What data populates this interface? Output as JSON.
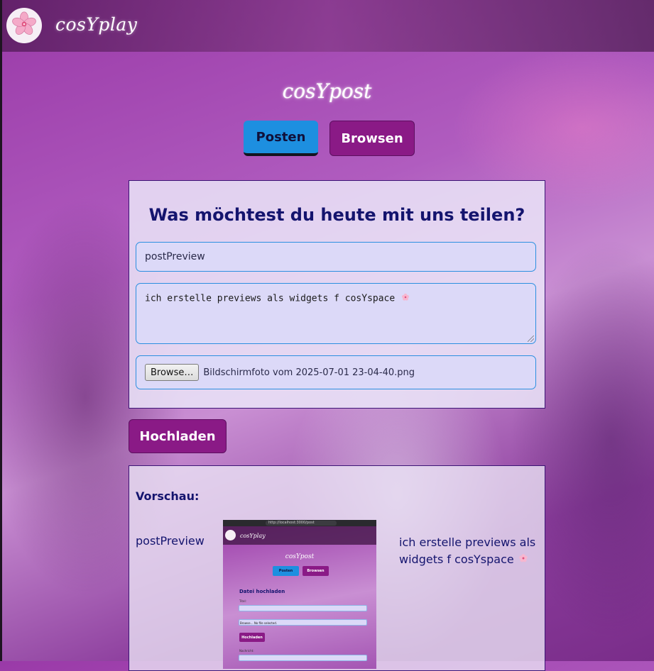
{
  "header": {
    "brand": "cosYplay",
    "logo_icon": "cherry-blossom-icon"
  },
  "page": {
    "title": "cosYpost"
  },
  "tabs": [
    {
      "label": "Posten",
      "active": true,
      "color": "#1d8fe0"
    },
    {
      "label": "Browsen",
      "active": false,
      "color": "#8a1a86"
    }
  ],
  "form": {
    "heading": "Was möchtest du heute mit uns teilen?",
    "title_value": "postPreview",
    "text_value": "ich erstelle previews als widgets f cosYspace",
    "browse_label": "Browse…",
    "file_name": "Bildschirmfoto vom 2025-07-01 23-04-40.png"
  },
  "upload_button": "Hochladen",
  "preview": {
    "heading": "Vorschau:",
    "title": "postPreview",
    "text": "ich erstelle previews als widgets f cosYspace",
    "image": {
      "url": "http://localhost:3000/post",
      "brand": "cosYplay",
      "title": "cosYpost",
      "tab_posten": "Posten",
      "tab_browsen": "Browsen",
      "form_title": "Datei hochladen",
      "label_title": "Titel:",
      "browse": "Browse…  No file selected.",
      "upload": "Hochladen",
      "label_text": "Nachricht:"
    }
  },
  "colors": {
    "accent_blue": "#1d8fe0",
    "accent_purple": "#8a1a86",
    "heading_navy": "#14146e"
  }
}
